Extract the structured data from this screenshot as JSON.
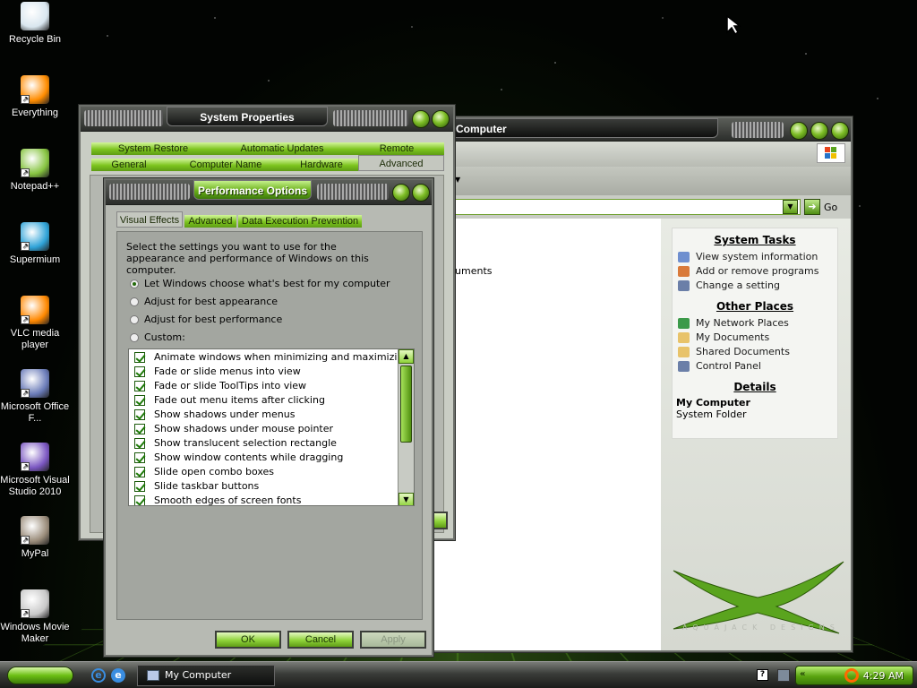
{
  "desktop": {
    "icons": [
      {
        "label": "Recycle Bin",
        "icon": "recycle-bin-icon",
        "color": "#d9e6ef"
      },
      {
        "label": "Everything",
        "icon": "everything-search-icon",
        "color": "#ff8c00"
      },
      {
        "label": "Notepad++",
        "icon": "notepad-plus-plus-icon",
        "color": "#86c440"
      },
      {
        "label": "Supermium",
        "icon": "supermium-browser-icon",
        "color": "#2fa3d8"
      },
      {
        "label": "VLC media player",
        "icon": "vlc-cone-icon",
        "color": "#ff8800"
      },
      {
        "label": "Microsoft Office F...",
        "icon": "office-icon",
        "color": "#6a7bb8"
      },
      {
        "label": "Microsoft Visual Studio 2010",
        "icon": "visual-studio-icon",
        "color": "#7b57c2"
      },
      {
        "label": "MyPal",
        "icon": "mypal-raccoon-icon",
        "color": "#9a8c7a"
      },
      {
        "label": "Windows Movie Maker",
        "icon": "movie-maker-icon",
        "color": "#c8c8c8"
      }
    ]
  },
  "explorer": {
    "title": "Computer",
    "go_label": "Go",
    "content_text": "cuments",
    "system_tasks": {
      "heading": "System Tasks",
      "items": [
        "View system information",
        "Add or remove programs",
        "Change a setting"
      ]
    },
    "other_places": {
      "heading": "Other Places",
      "items": [
        "My Network Places",
        "My Documents",
        "Shared Documents",
        "Control Panel"
      ]
    },
    "details": {
      "heading": "Details",
      "name": "My Computer",
      "type": "System Folder"
    },
    "watermark": "AQUAJACK DESIGNS"
  },
  "system_properties": {
    "title": "System Properties",
    "tabs_row1": [
      "System Restore",
      "Automatic Updates",
      "Remote"
    ],
    "tabs_row2": [
      "General",
      "Computer Name",
      "Hardware",
      "Advanced"
    ],
    "active_tab": "Advanced"
  },
  "performance_options": {
    "title": "Performance Options",
    "tabs": [
      "Visual Effects",
      "Advanced",
      "Data Execution Prevention"
    ],
    "active_tab": "Visual Effects",
    "description": "Select the settings you want to use for the appearance and performance of Windows on this computer.",
    "radios": [
      {
        "label": "Let Windows choose what's best for my computer",
        "selected": true
      },
      {
        "label": "Adjust for best appearance",
        "selected": false
      },
      {
        "label": "Adjust for best performance",
        "selected": false
      },
      {
        "label": "Custom:",
        "selected": false
      }
    ],
    "effects": [
      "Animate windows when minimizing and maximizing",
      "Fade or slide menus into view",
      "Fade or slide ToolTips into view",
      "Fade out menu items after clicking",
      "Show shadows under menus",
      "Show shadows under mouse pointer",
      "Show translucent selection rectangle",
      "Show window contents while dragging",
      "Slide open combo boxes",
      "Slide taskbar buttons",
      "Smooth edges of screen fonts"
    ],
    "ok_label": "OK",
    "cancel_label": "Cancel",
    "apply_label": "Apply"
  },
  "taskbar": {
    "window_button": "My Computer",
    "clock": "4:29 AM",
    "accent": "#7cc41e"
  }
}
